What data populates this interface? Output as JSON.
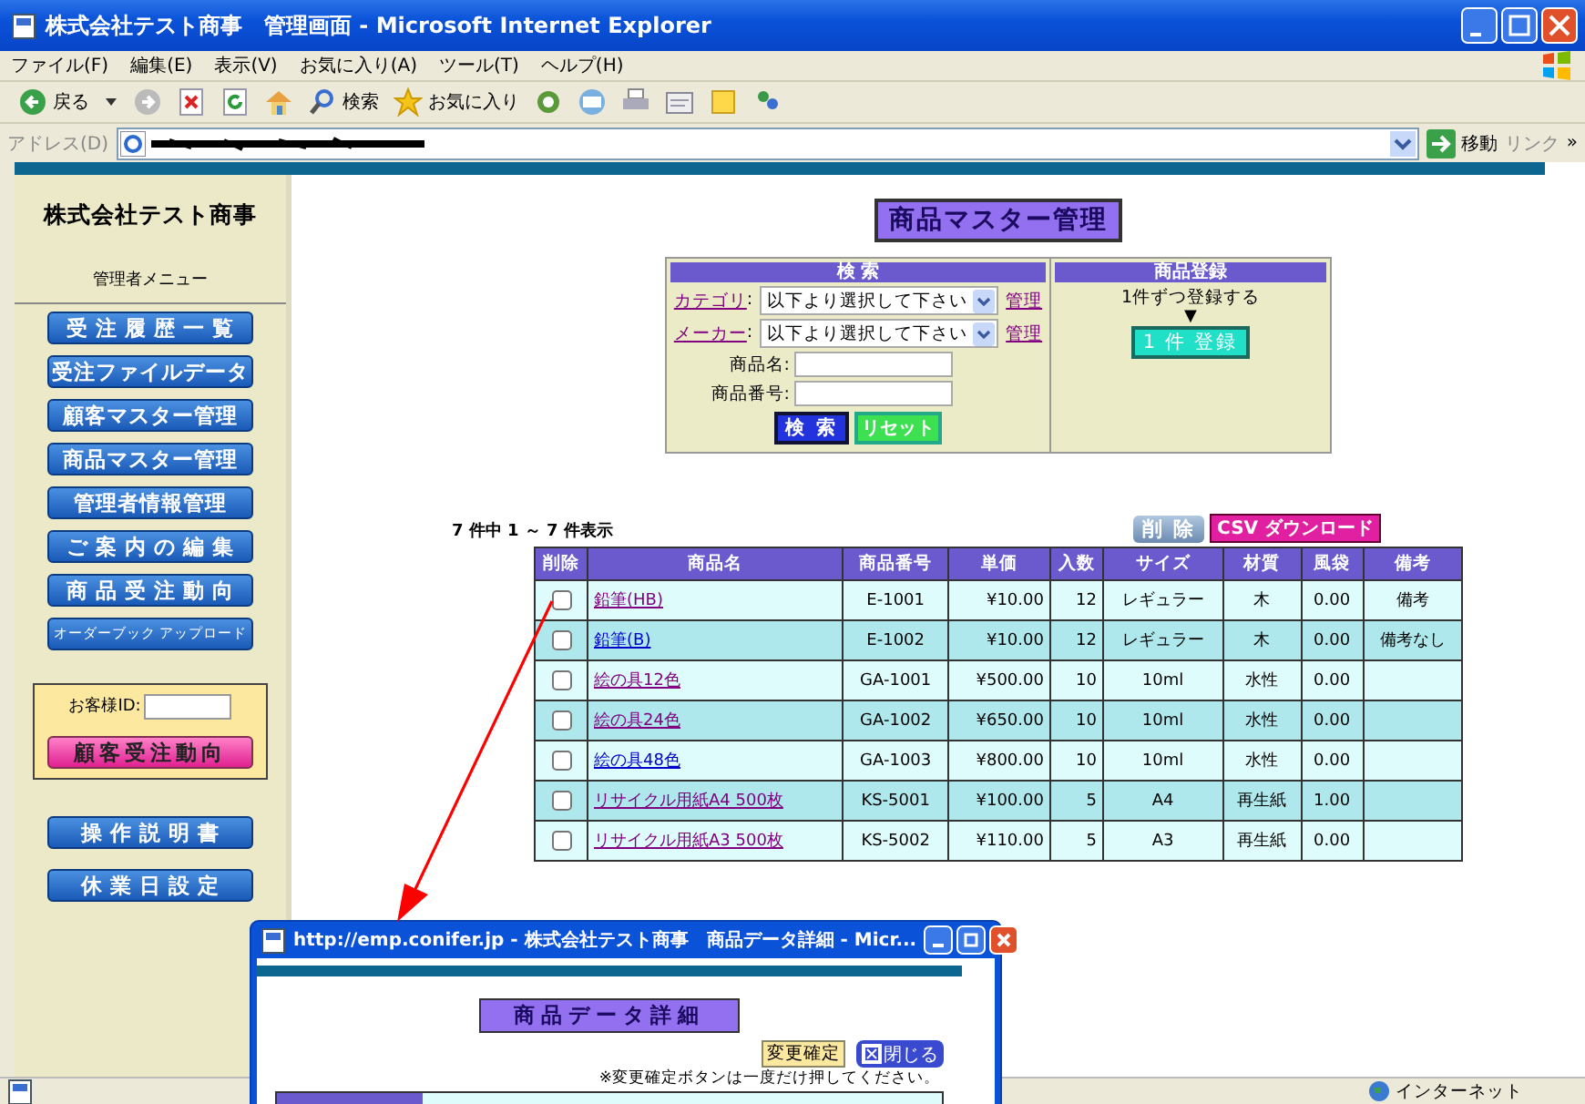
{
  "window": {
    "title": "株式会社テスト商事　管理画面 - Microsoft Internet Explorer"
  },
  "menu": [
    "ファイル(F)",
    "編集(E)",
    "表示(V)",
    "お気に入り(A)",
    "ツール(T)",
    "ヘルプ(H)"
  ],
  "toolbar": {
    "back": "戻る",
    "search": "検索",
    "favorites": "お気に入り"
  },
  "address": {
    "label": "アドレス(D)",
    "go": "移動",
    "links": "リンク",
    "more": "»"
  },
  "sidebar": {
    "company": "株式会社テスト商事",
    "menu_label": "管理者メニュー",
    "buttons": [
      "受 注 履 歴 一 覧",
      "受注ファイルデータ",
      "顧客マスター管理",
      "商品マスター管理",
      "管理者情報管理",
      "ご 案 内 の 編 集",
      "商 品 受 注 動 向",
      "オーダーブック アップロード"
    ],
    "customer_id_label": "お客様ID:",
    "customer_button": "顧客受注動向",
    "bottom_buttons": [
      "操 作 説 明 書",
      "休 業 日 設 定"
    ]
  },
  "heading": "商品マスター管理",
  "search_panel": {
    "header": "検 索",
    "selects": [
      {
        "label": "カテゴリ",
        "separator": ":",
        "value": "以下より選択して下さい",
        "link": "管理"
      },
      {
        "label": "メーカー",
        "separator": ":",
        "value": "以下より選択して下さい",
        "link": "管理"
      }
    ],
    "fields": [
      "商品名:",
      "商品番号:"
    ],
    "search_button": "検 索",
    "reset_button": "リセット"
  },
  "register_panel": {
    "header": "商品登録",
    "text": "1件ずつ登録する",
    "arrow": "▼",
    "button": "1 件 登録"
  },
  "list": {
    "count": "7 件中 1 ～ 7 件表示",
    "delete_button": "削 除",
    "csv_button": "CSV ダウンロード"
  },
  "table": {
    "columns": [
      "削除",
      "商品名",
      "商品番号",
      "単価",
      "入数",
      "サイズ",
      "材質",
      "風袋",
      "備考"
    ],
    "rows": [
      {
        "checked": false,
        "visited": true,
        "name": "鉛筆(HB)",
        "code": "E-1001",
        "price": "¥10.00",
        "qty": "12",
        "size": "レギュラー",
        "material": "木",
        "tare": "0.00",
        "note": "備考"
      },
      {
        "checked": false,
        "visited": false,
        "name": "鉛筆(B)",
        "code": "E-1002",
        "price": "¥10.00",
        "qty": "12",
        "size": "レギュラー",
        "material": "木",
        "tare": "0.00",
        "note": "備考なし"
      },
      {
        "checked": false,
        "visited": true,
        "name": "絵の具12色",
        "code": "GA-1001",
        "price": "¥500.00",
        "qty": "10",
        "size": "10ml",
        "material": "水性",
        "tare": "0.00"
      },
      {
        "checked": false,
        "visited": true,
        "name": "絵の具24色",
        "code": "GA-1002",
        "price": "¥650.00",
        "qty": "10",
        "size": "10ml",
        "material": "水性",
        "tare": "0.00"
      },
      {
        "checked": false,
        "visited": false,
        "name": "絵の具48色",
        "code": "GA-1003",
        "price": "¥800.00",
        "qty": "10",
        "size": "10ml",
        "material": "水性",
        "tare": "0.00"
      },
      {
        "checked": false,
        "visited": true,
        "name": "リサイクル用紙A4 500枚",
        "code": "KS-5001",
        "price": "¥100.00",
        "qty": "5",
        "size": "A4",
        "material": "再生紙",
        "tare": "1.00"
      },
      {
        "checked": false,
        "visited": true,
        "name": "リサイクル用紙A3 500枚",
        "code": "KS-5002",
        "price": "¥110.00",
        "qty": "5",
        "size": "A3",
        "material": "再生紙",
        "tare": "0.00"
      }
    ]
  },
  "popup": {
    "title": "http://emp.conifer.jp - 株式会社テスト商事　商品データ詳細 - Micr...",
    "heading": "商品データ詳細",
    "confirm_button": "変更確定",
    "close_button": "閉じる",
    "note": "※変更確定ボタンは一度だけ押してください。"
  },
  "status_bar": {
    "zone": "インターネット"
  }
}
